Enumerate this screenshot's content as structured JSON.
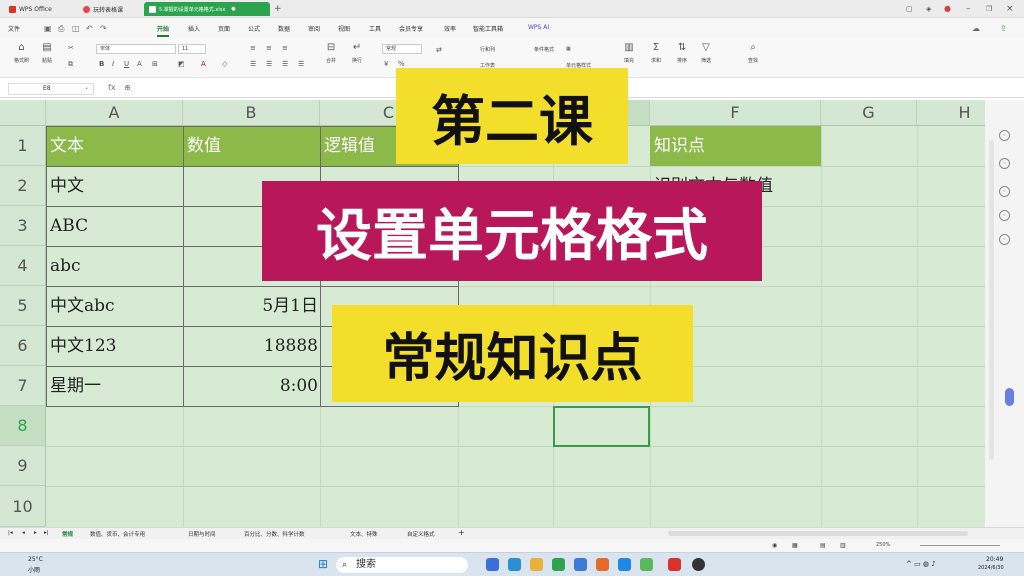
{
  "titlebar": {
    "app_tab": "WPS Office",
    "stick_tab": "玩转表格课",
    "file_tab": "5.掌握的设置单元格格式.xlsx"
  },
  "menu": [
    "文件",
    "开始",
    "插入",
    "页面",
    "公式",
    "数据",
    "审阅",
    "视图",
    "工具",
    "会员专享",
    "效率",
    "智能工具箱",
    "WPS AI"
  ],
  "ribbon": {
    "format_painter": "格式刷",
    "paste": "粘贴",
    "font_name": "宋体",
    "font_size": "11",
    "number_format": "常规",
    "merge": "合并",
    "wrap": "换行",
    "row_col": "行和列",
    "worksheet": "工作表",
    "cond_format": "条件格式",
    "cell_style": "单元格样式",
    "fill": "填充",
    "sum": "求和",
    "sort": "排序",
    "filter": "筛选",
    "find": "查找"
  },
  "formula": {
    "name_box": "E8",
    "fx": "fx"
  },
  "columns": [
    "A",
    "B",
    "C",
    "D",
    "E",
    "F",
    "G",
    "H"
  ],
  "rows": [
    "1",
    "2",
    "3",
    "4",
    "5",
    "6",
    "7",
    "8",
    "9",
    "10"
  ],
  "table": {
    "headers": [
      "文本",
      "数值",
      "逻辑值"
    ],
    "col_a": [
      "中文",
      "ABC",
      "abc",
      "中文abc",
      "中文123",
      "星期一"
    ],
    "col_b": [
      "",
      "",
      "",
      "5月1日",
      "18888",
      "8:00"
    ]
  },
  "knowledge": {
    "header": "知识点",
    "row2": "识别文本与数值"
  },
  "overlays": {
    "banner1": "第二课",
    "banner2": "设置单元格格式",
    "banner3": "常规知识点"
  },
  "sheets": [
    "常规",
    "数值、货币、会计专用",
    "日期与时间",
    "百分比、分数、科学计数",
    "文本、特殊",
    "自定义格式"
  ],
  "status": {
    "zoom": "250%"
  },
  "taskbar": {
    "weather_temp": "25°C",
    "weather_desc": "小雨",
    "search": "搜索",
    "time": "20:49",
    "date": "2024/6/30"
  }
}
